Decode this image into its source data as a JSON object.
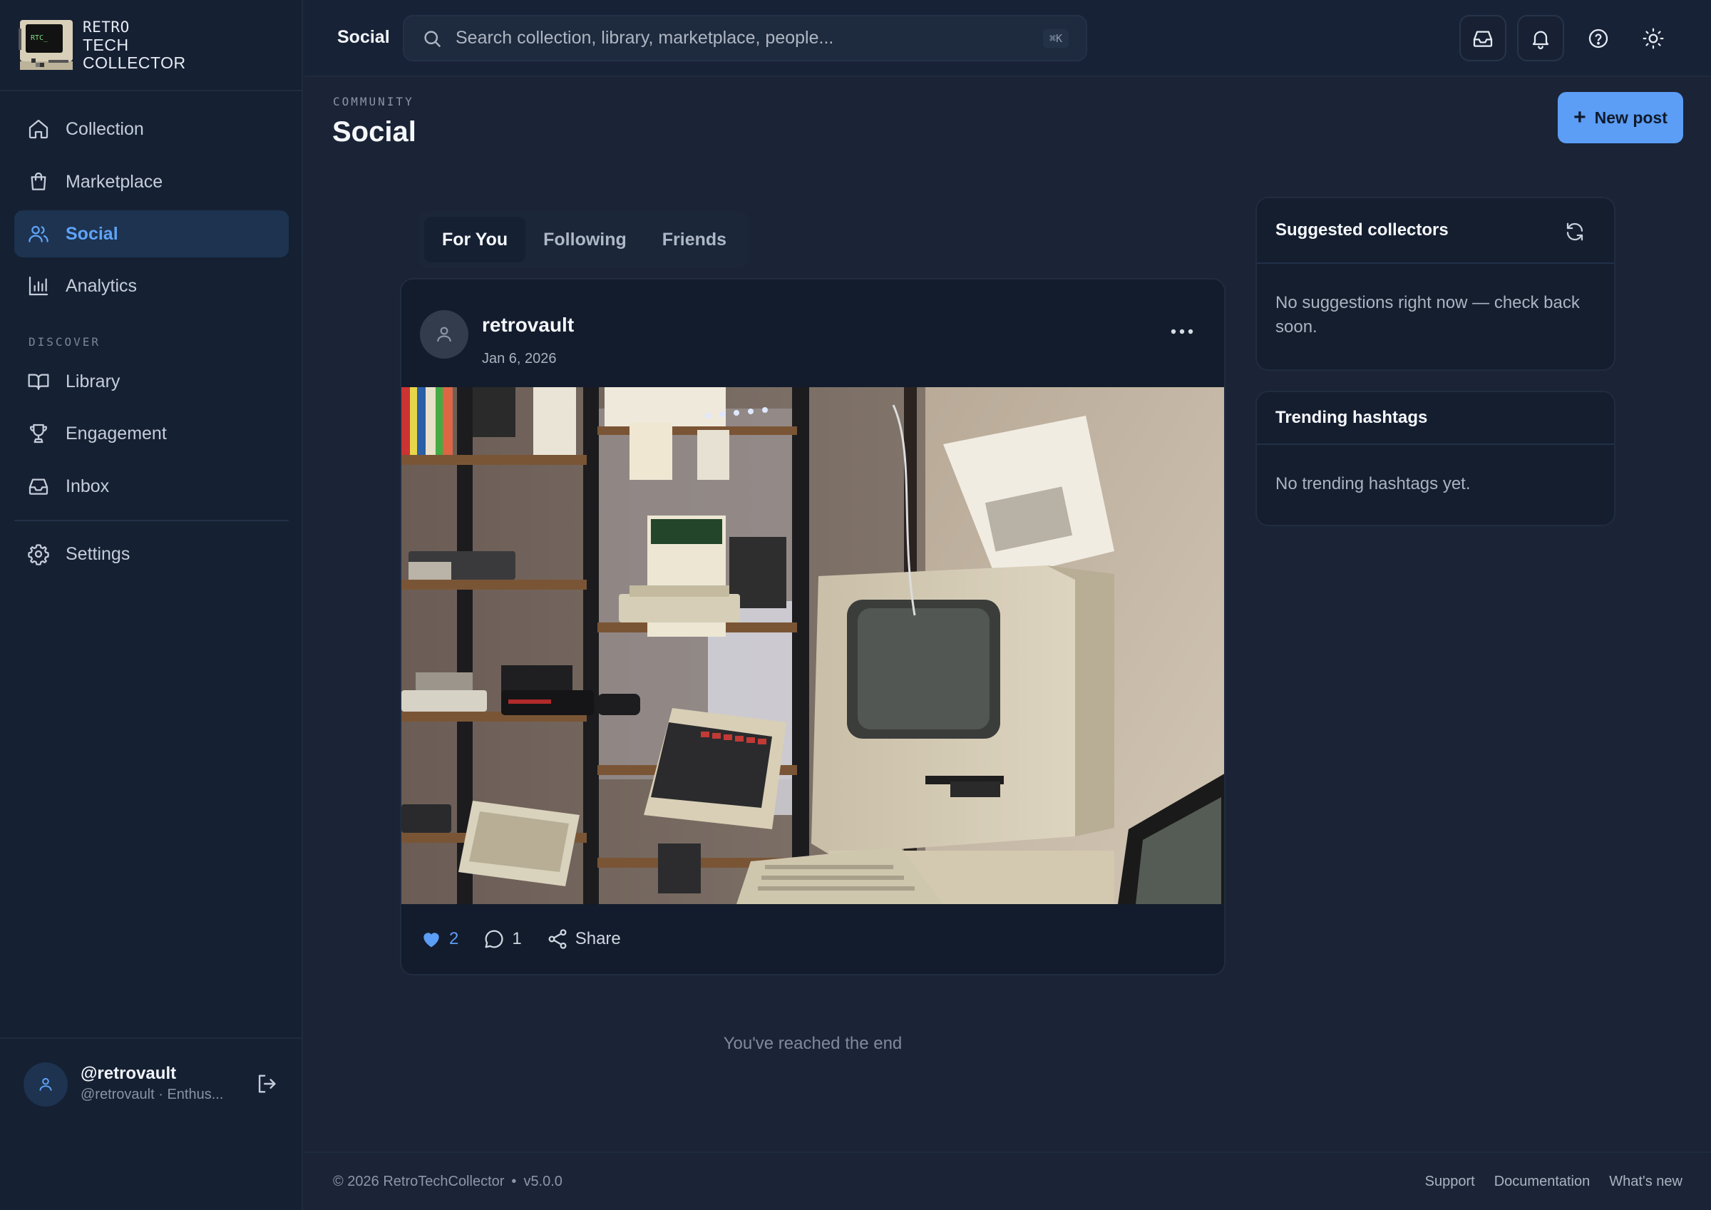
{
  "brand": {
    "lines": [
      "RETRO",
      "TECH",
      "COLLECTOR"
    ],
    "logo_screen_text": "RTC_"
  },
  "sidebar": {
    "items": [
      {
        "label": "Collection",
        "icon": "home-icon"
      },
      {
        "label": "Marketplace",
        "icon": "shopping-bag-icon"
      },
      {
        "label": "Social",
        "icon": "users-icon",
        "active": true
      },
      {
        "label": "Analytics",
        "icon": "bar-chart-icon"
      }
    ],
    "discover_label": "DISCOVER",
    "discover_items": [
      {
        "label": "Library",
        "icon": "book-icon"
      },
      {
        "label": "Engagement",
        "icon": "trophy-icon"
      },
      {
        "label": "Inbox",
        "icon": "inbox-icon"
      }
    ],
    "settings_label": "Settings",
    "user": {
      "name": "@retrovault",
      "subtitle": "@retrovault · Enthus..."
    }
  },
  "topbar": {
    "title": "Social",
    "search_placeholder": "Search collection, library, marketplace, people...",
    "shortcut": "⌘K"
  },
  "page": {
    "eyebrow": "COMMUNITY",
    "title": "Social",
    "new_post_label": "New post"
  },
  "tabs": [
    {
      "label": "For You",
      "active": true
    },
    {
      "label": "Following"
    },
    {
      "label": "Friends"
    }
  ],
  "post": {
    "author": "retrovault",
    "date": "Jan 6, 2026",
    "likes": "2",
    "comments": "1",
    "share_label": "Share",
    "liked": true
  },
  "feed_end": "You've reached the end",
  "suggested": {
    "title": "Suggested collectors",
    "empty": "No suggestions right now — check back soon."
  },
  "trending": {
    "title": "Trending hashtags",
    "empty": "No trending hashtags yet."
  },
  "footer": {
    "copyright": "© 2026 RetroTechCollector",
    "version": "v5.0.0",
    "links": [
      "Support",
      "Documentation",
      "What's new"
    ]
  },
  "colors": {
    "accent": "#5c9df5",
    "background": "#1a2436",
    "sidebar": "#152033"
  }
}
